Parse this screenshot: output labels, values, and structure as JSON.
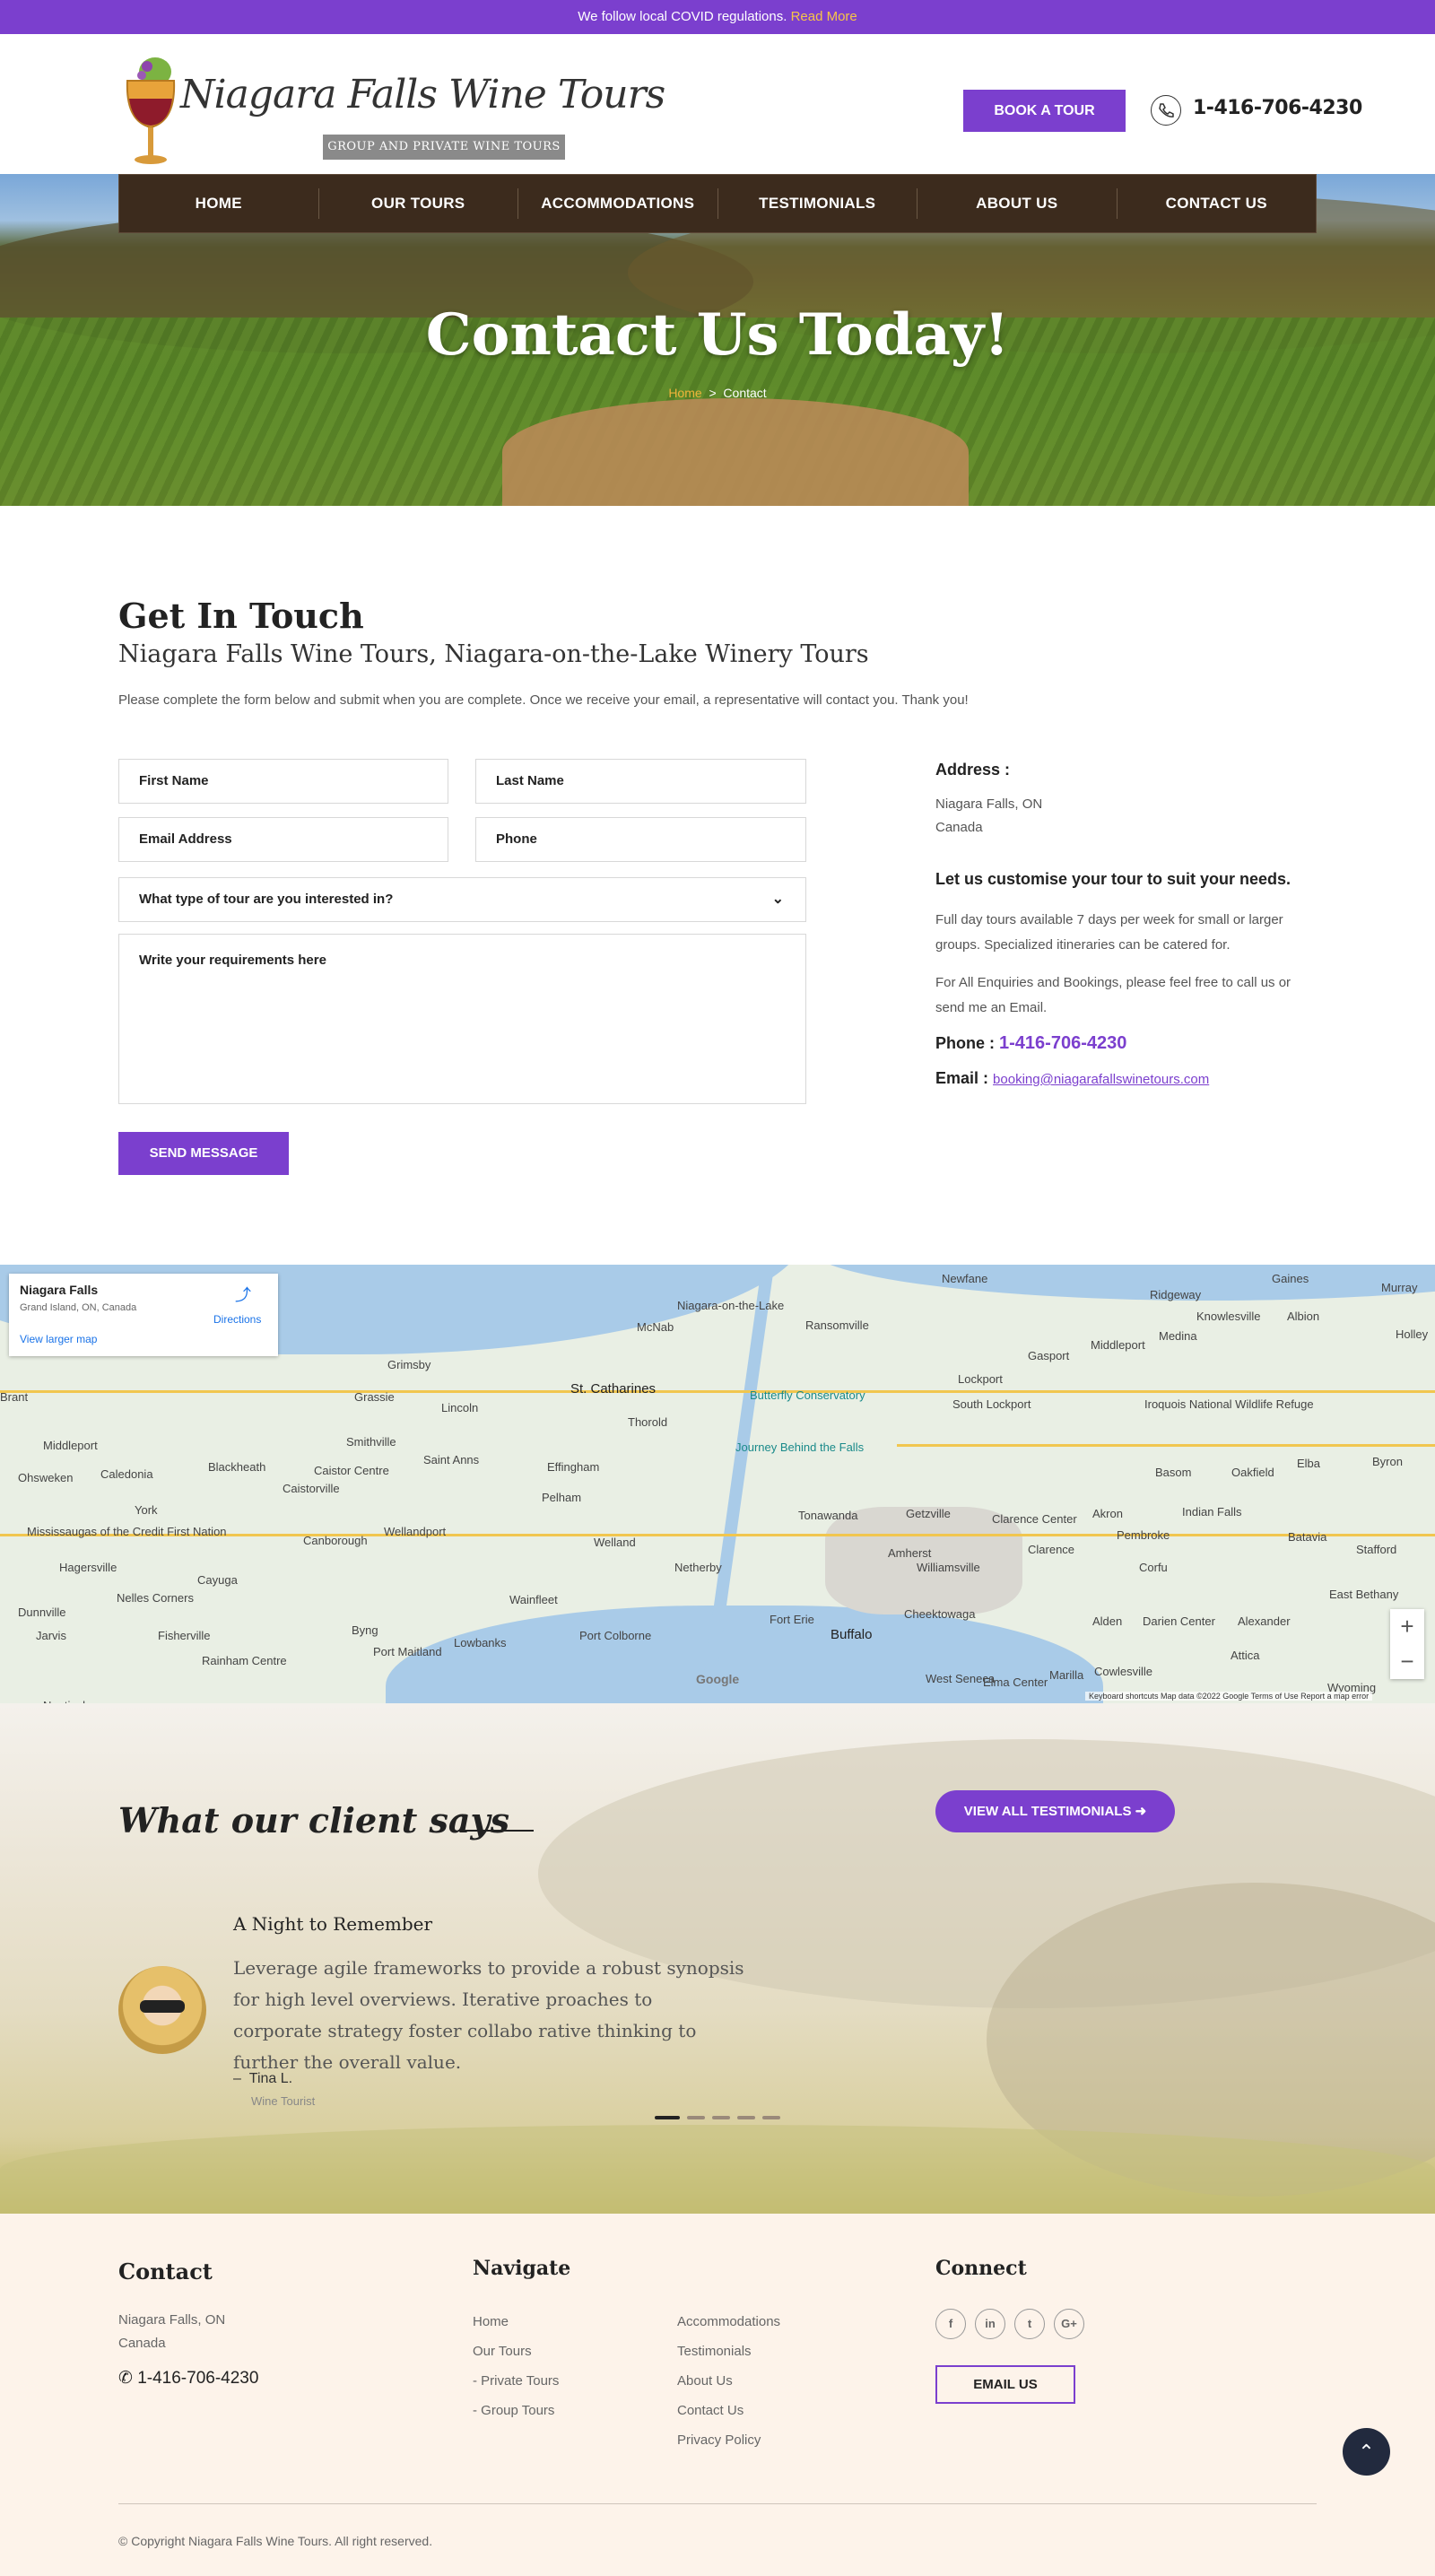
{
  "topbar": {
    "text": "We follow local COVID regulations.",
    "link": "Read More"
  },
  "header": {
    "logo_text": "Niagara Falls Wine Tours",
    "logo_sub": "GROUP AND PRIVATE WINE TOURS",
    "book_label": "BOOK A TOUR",
    "phone": "1-416-706-4230"
  },
  "nav": {
    "items": [
      "HOME",
      "OUR TOURS",
      "ACCOMMODATIONS",
      "TESTIMONIALS",
      "ABOUT US",
      "CONTACT US"
    ]
  },
  "hero": {
    "title": "Contact Us Today!",
    "crumb_home": "Home",
    "crumb_sep": ">",
    "crumb_current": "Contact"
  },
  "contact": {
    "title": "Get In Touch",
    "subtitle": "Niagara Falls Wine Tours, Niagara-on-the-Lake Winery Tours",
    "intro": "Please complete the form below and submit when you are complete. Once we receive your email, a representative will contact you. Thank you!",
    "form": {
      "first_name": "First Name",
      "last_name": "Last Name",
      "email": "Email Address",
      "phone": "Phone",
      "tour_type": "What type of tour are you interested in?",
      "requirements": "Write your requirements here",
      "send": "SEND MESSAGE"
    },
    "address_label": "Address :",
    "address_line1": "Niagara Falls, ON",
    "address_line2": "Canada",
    "customise_title": "Let us customise your tour to suit your needs.",
    "customise_text": "Full day tours available 7 days per week for small or larger groups. Specialized itineraries can be catered for.",
    "enquiries_text": "For All Enquiries and Bookings, please feel free to call us or send me an Email.",
    "phone_label": "Phone :",
    "phone": "1-416-706-4230",
    "email_label": "Email :",
    "email": "booking@niagarafallswinetours.com"
  },
  "map": {
    "card_title": "Niagara Falls",
    "card_sub": "Grand Island, ON, Canada",
    "card_link": "View larger map",
    "directions": "Directions",
    "zoom_in": "+",
    "zoom_out": "−",
    "footer": "Keyboard shortcuts   Map data ©2022 Google   Terms of Use   Report a map error",
    "google": "Google",
    "labels": [
      "Niagara-on-the-Lake",
      "McNab",
      "Ransomville",
      "Newfane",
      "Gaines",
      "Murray",
      "Ridgeway",
      "Knowlesville",
      "Albion",
      "Holley",
      "Grimsby",
      "Lincoln",
      "St. Catharines",
      "Butterfly Conservatory",
      "Journey Behind the Falls",
      "Thorold",
      "Middleport",
      "Medina",
      "Gasport",
      "Lockport",
      "South Lockport",
      "Grassie",
      "Smithville",
      "Saint Anns",
      "Effingham",
      "Pelham",
      "Welland",
      "Tonawanda",
      "Getzville",
      "Clarence Center",
      "Akron",
      "Indian Falls",
      "Basom",
      "Oakfield",
      "Elba",
      "Byron",
      "Caledonia",
      "Blackheath",
      "Caistor Centre",
      "Caistorville",
      "York",
      "Canborough",
      "Wellandport",
      "Wainfleet",
      "Port Colborne",
      "Netherby",
      "Amherst",
      "Williamsville",
      "Clarence",
      "Pembroke",
      "Corfu",
      "Batavia",
      "Stafford",
      "Hagersville",
      "Cayuga",
      "Nelles Corners",
      "Fisherville",
      "Jarvis",
      "Rainham Centre",
      "Port Maitland",
      "Lowbanks",
      "Dunnville",
      "Byng",
      "Cheektowaga",
      "Buffalo",
      "Fort Erie",
      "Alden",
      "Darien Center",
      "Alexander",
      "Attica",
      "East Bethany",
      "Marilla",
      "Cowlesville",
      "Elma Center",
      "West Seneca",
      "Wyoming",
      "Middleport",
      "Ohsweken",
      "Mississaugas of the Credit First Nation",
      "Nanticoke",
      "Iroquois National Wildlife Refuge",
      "Brant"
    ]
  },
  "testimonials": {
    "title": "What our client says",
    "all_label": "VIEW ALL TESTIMONIALS",
    "quote_title": "A Night to Remember",
    "quote": "Leverage agile frameworks to provide a robust synopsis for high level overviews. Iterative proaches to corporate strategy foster collabo rative thinking to further the overall value.",
    "name": "Tina L.",
    "role": "Wine Tourist"
  },
  "footer": {
    "contact_title": "Contact",
    "line1": "Niagara Falls, ON",
    "line2": "Canada",
    "phone": "1-416-706-4230",
    "navigate_title": "Navigate",
    "nav_col1": [
      "Home",
      "Our Tours",
      "- Private Tours",
      "- Group Tours"
    ],
    "nav_col2": [
      "Accommodations",
      "Testimonials",
      "About Us",
      "Contact Us",
      "Privacy Policy"
    ],
    "connect_title": "Connect",
    "social": [
      "f",
      "in",
      "t",
      "G+"
    ],
    "email_btn": "EMAIL US",
    "copyright": "© Copyright Niagara Falls Wine Tours. All right reserved."
  },
  "colors": {
    "accent": "#7b3fce",
    "highlight": "#f7c548",
    "nav_bg": "#3c2b1d",
    "footer_bg": "#fdf3ea"
  }
}
